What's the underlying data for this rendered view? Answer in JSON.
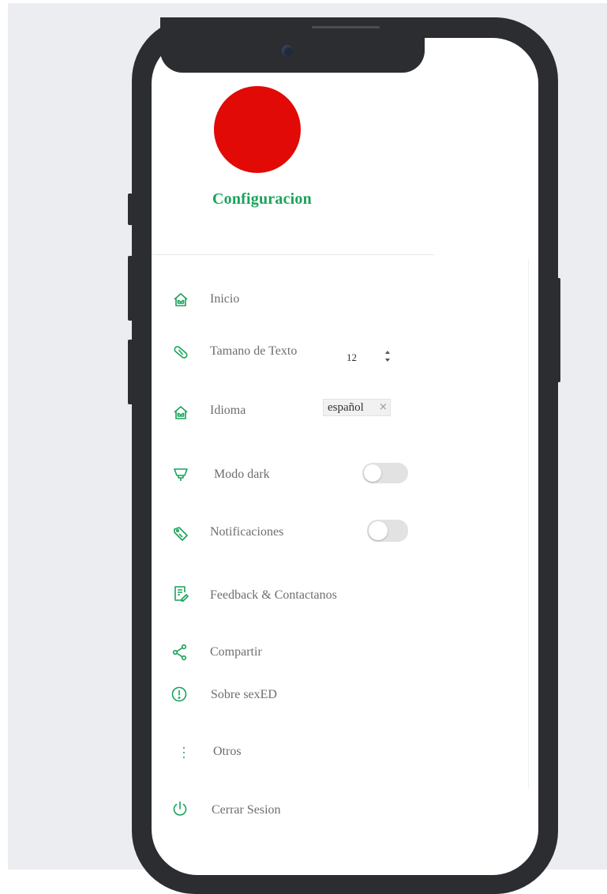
{
  "colors": {
    "accent": "#19a35a",
    "avatar": "#e10a06",
    "phone_frame": "#2b2d30",
    "label_text": "#6e6e6e",
    "toggle_off": "#e2e2e2"
  },
  "header": {
    "title": "Configuracion"
  },
  "menu": [
    {
      "label": "Inicio",
      "icon": "home-icon"
    },
    {
      "label": "Tamano de Texto",
      "icon": "pill-icon",
      "control": {
        "type": "stepper",
        "value": "12"
      }
    },
    {
      "label": "Idioma",
      "icon": "home-icon",
      "control": {
        "type": "select",
        "value": "español",
        "clear": "×"
      }
    },
    {
      "label": "Modo dark",
      "icon": "lamp-icon",
      "control": {
        "type": "toggle",
        "on": false
      }
    },
    {
      "label": "Notificaciones",
      "icon": "tag-icon",
      "control": {
        "type": "toggle",
        "on": false
      }
    },
    {
      "label": "Feedback & Contactanos",
      "icon": "edit-document-icon"
    },
    {
      "label": "Compartir",
      "icon": "share-icon"
    },
    {
      "label": "Sobre sexED",
      "icon": "info-circle-icon"
    },
    {
      "label": "Otros",
      "icon": "more-vertical-icon"
    },
    {
      "label": "Cerrar Sesion",
      "icon": "power-icon"
    }
  ]
}
